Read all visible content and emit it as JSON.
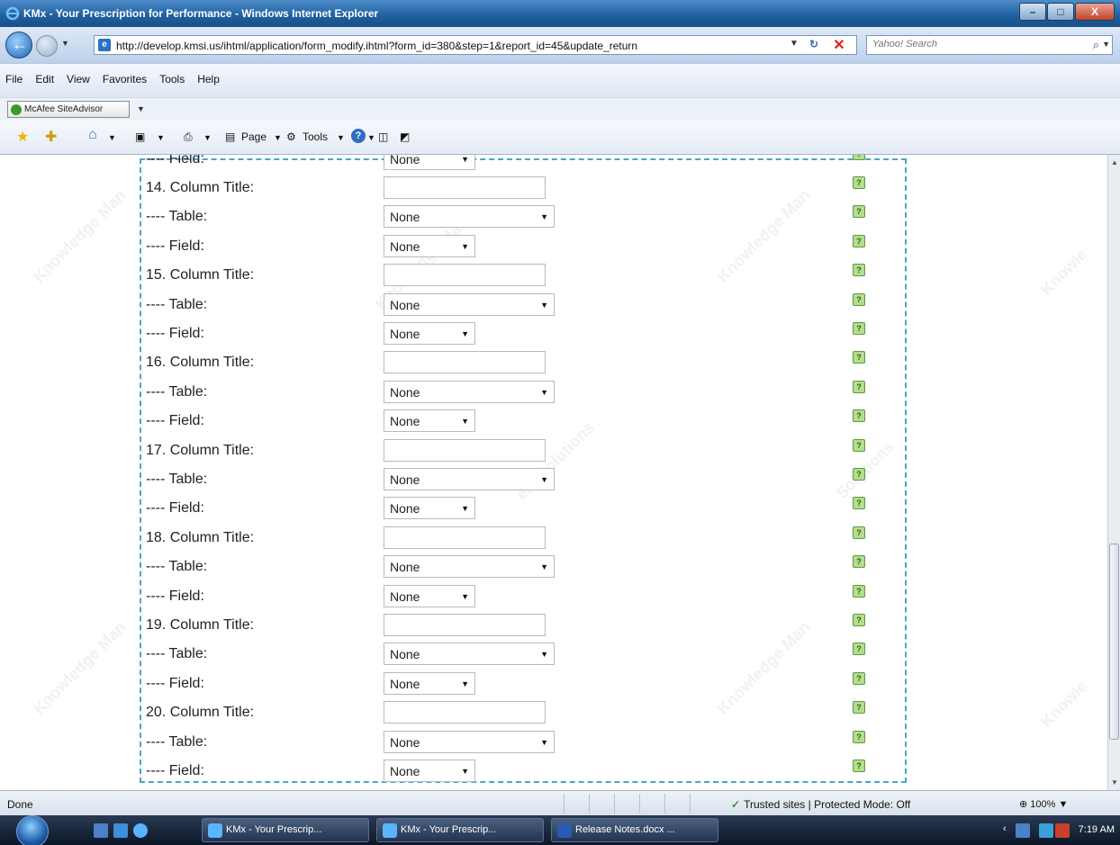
{
  "window": {
    "title": "KMx - Your Prescription for Performance - Windows Internet Explorer",
    "minimize": "–",
    "maximize": "□",
    "close": "X"
  },
  "address": {
    "url": "http://develop.kmsi.us/ihtml/application/form_modify.ihtml?form_id=380&step=1&report_id=45&update_return",
    "search_placeholder": "Yahoo! Search"
  },
  "menu": {
    "items": [
      "File",
      "Edit",
      "View",
      "Favorites",
      "Tools",
      "Help"
    ]
  },
  "mcafee": {
    "label": "McAfee SiteAdvisor"
  },
  "commandbar": {
    "page_label": "Page",
    "tools_label": "Tools"
  },
  "form": {
    "partial_top_label": "---- Field:",
    "partial_top_select": "None",
    "rows": [
      {
        "label": "14. Column Title:",
        "kind": "text",
        "value": ""
      },
      {
        "label": "---- Table:",
        "kind": "table",
        "value": "None"
      },
      {
        "label": "---- Field:",
        "kind": "field",
        "value": "None"
      },
      {
        "label": "15. Column Title:",
        "kind": "text",
        "value": ""
      },
      {
        "label": "---- Table:",
        "kind": "table",
        "value": "None"
      },
      {
        "label": "---- Field:",
        "kind": "field",
        "value": "None"
      },
      {
        "label": "16. Column Title:",
        "kind": "text",
        "value": ""
      },
      {
        "label": "---- Table:",
        "kind": "table",
        "value": "None"
      },
      {
        "label": "---- Field:",
        "kind": "field",
        "value": "None"
      },
      {
        "label": "17. Column Title:",
        "kind": "text",
        "value": ""
      },
      {
        "label": "---- Table:",
        "kind": "table",
        "value": "None"
      },
      {
        "label": "---- Field:",
        "kind": "field",
        "value": "None"
      },
      {
        "label": "18. Column Title:",
        "kind": "text",
        "value": ""
      },
      {
        "label": "---- Table:",
        "kind": "table",
        "value": "None"
      },
      {
        "label": "---- Field:",
        "kind": "field",
        "value": "None"
      },
      {
        "label": "19. Column Title:",
        "kind": "text",
        "value": ""
      },
      {
        "label": "---- Table:",
        "kind": "table",
        "value": "None"
      },
      {
        "label": "---- Field:",
        "kind": "field",
        "value": "None"
      },
      {
        "label": "20. Column Title:",
        "kind": "text",
        "value": ""
      },
      {
        "label": "---- Table:",
        "kind": "table",
        "value": "None"
      },
      {
        "label": "---- Field:",
        "kind": "field",
        "value": "None"
      }
    ],
    "help_glyph": "?"
  },
  "status": {
    "text": "Done",
    "zone": "Trusted sites | Protected Mode: Off",
    "zoom": "100%"
  },
  "taskbar": {
    "buttons": [
      "KMx - Your Prescrip...",
      "KMx - Your Prescrip...",
      "Release Notes.docx ..."
    ],
    "clock": "7:19 AM"
  },
  "colors": {
    "frame_border": "#4aa6c8",
    "help_icon_bg": "#b5dc8f"
  }
}
